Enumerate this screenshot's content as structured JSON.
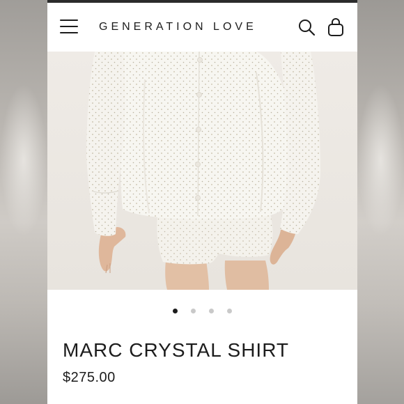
{
  "header": {
    "brand": "GENERATION LOVE",
    "menu_icon": "hamburger-menu-icon",
    "search_icon": "search-icon",
    "cart_icon": "shopping-bag-icon"
  },
  "hero": {
    "description_icon": "product-photo"
  },
  "carousel": {
    "total": 4,
    "active_index": 0
  },
  "product": {
    "title": "MARC CRYSTAL SHIRT",
    "price": "$275.00"
  },
  "colors": {
    "text": "#1c1c1c",
    "dot_active": "#1c1c1c",
    "dot_inactive": "#c9c9c9"
  }
}
